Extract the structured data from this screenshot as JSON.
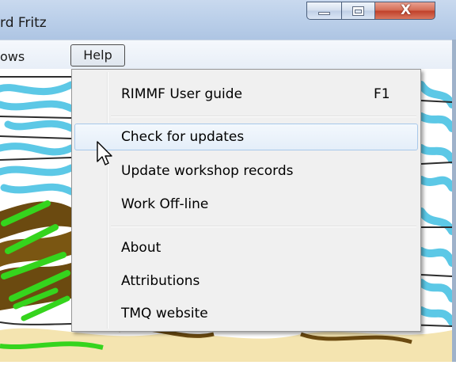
{
  "window": {
    "title": "rd Fritz",
    "close_glyph": "X",
    "caption_icons": [
      "minimize-icon",
      "maximize-icon",
      "close-icon"
    ]
  },
  "menubar": {
    "partial_item": "ows",
    "help_label": "Help"
  },
  "help_menu": {
    "items": [
      {
        "label": "RIMMF User guide",
        "shortcut": "F1"
      },
      {
        "label": "Check for updates",
        "highlighted": true
      },
      {
        "label": "Update workshop records"
      },
      {
        "label": "Work Off-line"
      },
      {
        "label": "About"
      },
      {
        "label": "Attributions"
      },
      {
        "label": "TMQ website"
      }
    ]
  },
  "colors": {
    "title_bar": "#bcd0ea",
    "close_button": "#c7462f",
    "menu_bg": "#f0f0f0",
    "highlight_border": "#a8c8ea",
    "drawing_cyan": "#5cc8e6",
    "drawing_brown": "#6b4a10",
    "drawing_green": "#35d41d"
  },
  "pointer_icon": "arrow-cursor-icon"
}
